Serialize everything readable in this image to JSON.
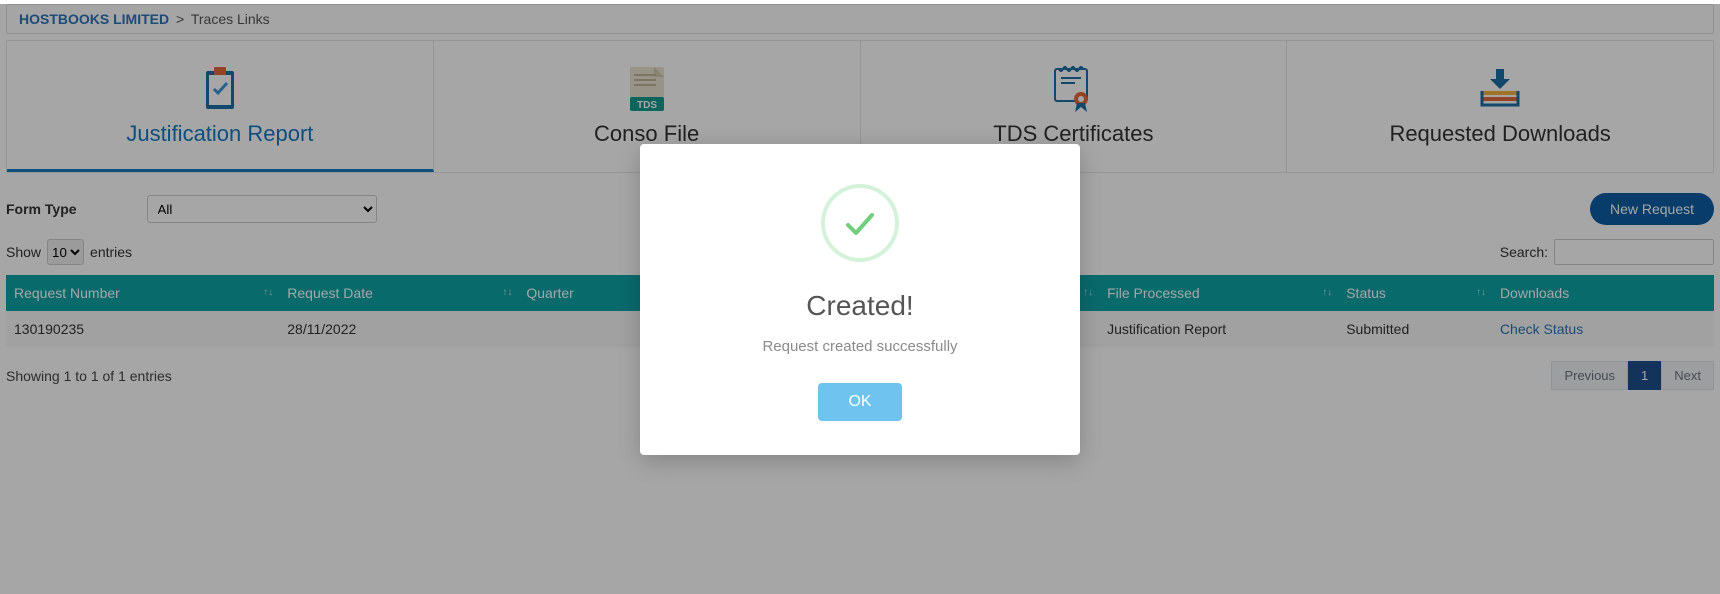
{
  "breadcrumb": {
    "org": "HOSTBOOKS LIMITED",
    "sep": ">",
    "current": "Traces Links"
  },
  "tabs": [
    {
      "label": "Justification Report"
    },
    {
      "label": "Conso File"
    },
    {
      "label": "TDS Certificates"
    },
    {
      "label": "Requested Downloads"
    }
  ],
  "filter": {
    "label": "Form Type",
    "selected": "All"
  },
  "new_request": "New Request",
  "table_top": {
    "show_prefix": "Show",
    "show_value": "10",
    "show_suffix": "entries",
    "search_label": "Search:"
  },
  "columns": {
    "c0": "Request Number",
    "c1": "Request Date",
    "c2": "Quarter",
    "c3": "File Processed",
    "c4": "Status",
    "c5": "Downloads"
  },
  "row": {
    "request_number": "130190235",
    "request_date": "28/11/2022",
    "quarter": "",
    "file_processed": "Justification Report",
    "status": "Submitted",
    "download_link": "Check Status"
  },
  "table_bottom": {
    "info": "Showing 1 to 1 of 1 entries",
    "prev": "Previous",
    "page": "1",
    "next": "Next"
  },
  "modal": {
    "title": "Created!",
    "message": "Request created successfully",
    "ok": "OK"
  }
}
